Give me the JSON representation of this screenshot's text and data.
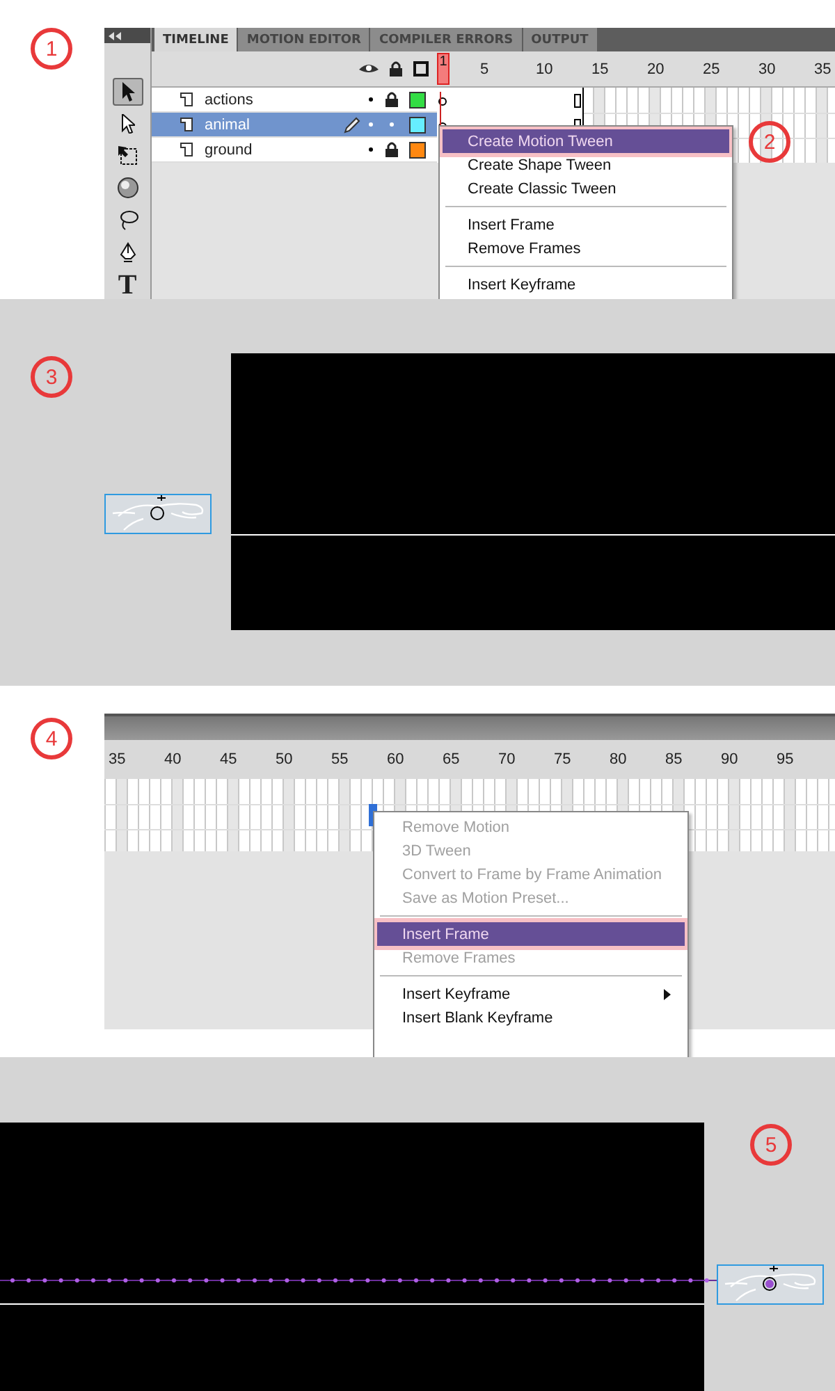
{
  "timeline_start": {
    "marker": "1",
    "text_tool": "T",
    "tabs": [
      {
        "label": "TIMELINE",
        "selected": true
      },
      {
        "label": "MOTION EDITOR",
        "selected": false
      },
      {
        "label": "COMPILER ERRORS",
        "selected": false
      },
      {
        "label": "OUTPUT",
        "selected": false
      }
    ],
    "ruler": [
      "1",
      "5",
      "10",
      "15",
      "20",
      "25",
      "30",
      "35"
    ],
    "layers": [
      {
        "name": "actions",
        "selected": false,
        "locked": true,
        "color": "#33dd44"
      },
      {
        "name": "animal",
        "selected": true,
        "locked": false,
        "color": "#66eeff"
      },
      {
        "name": "ground",
        "selected": false,
        "locked": true,
        "color": "#ff8811"
      }
    ],
    "menu": {
      "marker": "2",
      "items": [
        {
          "kind": "item",
          "label": "Create Motion Tween",
          "selected": true,
          "disabled": false
        },
        {
          "kind": "item",
          "label": "Create Shape Tween",
          "selected": false,
          "disabled": false
        },
        {
          "kind": "item",
          "label": "Create Classic Tween",
          "selected": false,
          "disabled": false
        },
        {
          "kind": "separator"
        },
        {
          "kind": "item",
          "label": "Insert Frame",
          "selected": false,
          "disabled": false
        },
        {
          "kind": "item",
          "label": "Remove Frames",
          "selected": false,
          "disabled": false
        },
        {
          "kind": "separator"
        },
        {
          "kind": "item",
          "label": "Insert Keyframe",
          "selected": false,
          "disabled": false
        }
      ]
    }
  },
  "stage_start": {
    "marker": "3"
  },
  "timeline_end": {
    "marker": "4",
    "ruler": [
      "35",
      "40",
      "45",
      "50",
      "55",
      "60",
      "65",
      "70",
      "75",
      "80",
      "85",
      "90",
      "95"
    ],
    "menu": {
      "items": [
        {
          "kind": "item",
          "label": "Remove Motion",
          "selected": false,
          "disabled": true
        },
        {
          "kind": "item",
          "label": "3D Tween",
          "selected": false,
          "disabled": true
        },
        {
          "kind": "item",
          "label": "Convert to Frame by Frame Animation",
          "selected": false,
          "disabled": true
        },
        {
          "kind": "item",
          "label": "Save as Motion Preset...",
          "selected": false,
          "disabled": true
        },
        {
          "kind": "separator"
        },
        {
          "kind": "item",
          "label": "Insert Frame",
          "selected": true,
          "disabled": false
        },
        {
          "kind": "item",
          "label": "Remove Frames",
          "selected": false,
          "disabled": true
        },
        {
          "kind": "separator"
        },
        {
          "kind": "item",
          "label": "Insert Keyframe",
          "selected": false,
          "disabled": false,
          "submenu": true
        },
        {
          "kind": "item",
          "label": "Insert Blank Keyframe",
          "selected": false,
          "disabled": false
        }
      ]
    }
  },
  "stage_end": {
    "marker": "5",
    "motion_path": true
  }
}
